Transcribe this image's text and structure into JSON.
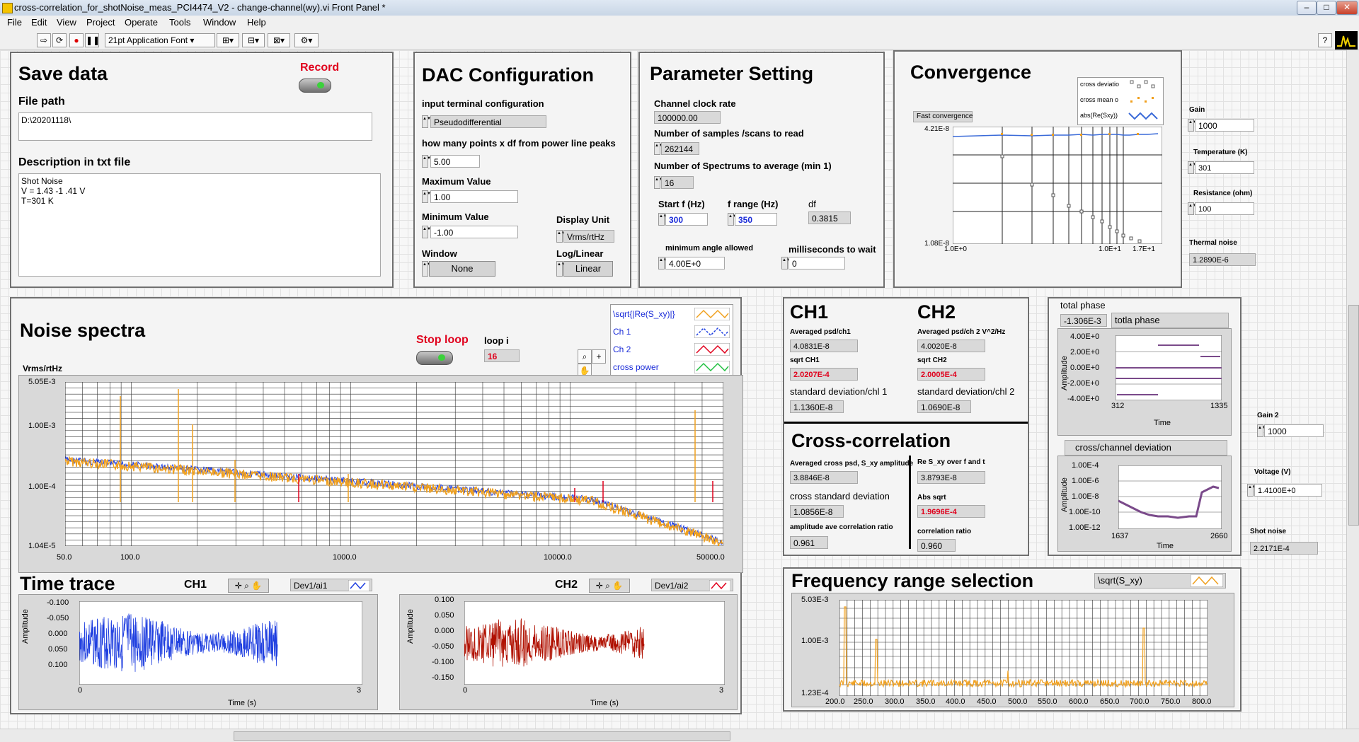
{
  "window": {
    "title": "cross-correlation_for_shotNoise_meas_PCI4474_V2 - change-channel(wy).vi Front Panel *"
  },
  "menu": [
    "File",
    "Edit",
    "View",
    "Project",
    "Operate",
    "Tools",
    "Window",
    "Help"
  ],
  "toolbar": {
    "font": "21pt Application Font"
  },
  "save": {
    "title": "Save data",
    "record_label": "Record",
    "file_path_label": "File path",
    "file_path": "D:\\20201118\\",
    "desc_label": "Description in txt file",
    "desc_lines": [
      "Shot Noise",
      "V = 1.43 -1 .41 V",
      "T=301 K"
    ]
  },
  "dac": {
    "title": "DAC Configuration",
    "input_term_label": "input terminal configuration",
    "input_term": "Pseudodifferential",
    "points_label": "how many points x df from power line peaks",
    "points": "5.00",
    "max_label": "Maximum Value",
    "max": "1.00",
    "min_label": "Minimum Value",
    "min": "-1.00",
    "display_unit_label": "Display Unit",
    "display_unit": "Vrms/rtHz",
    "window_label": "Window",
    "window": "None",
    "loglin_label": "Log/Linear",
    "loglin": "Linear"
  },
  "param": {
    "title": "Parameter Setting",
    "clock_label": "Channel clock rate",
    "clock": "100000.00",
    "samples_label": "Number of samples /scans to read",
    "samples": "262144",
    "spectrums_label": "Number of Spectrums to average (min 1)",
    "spectrums": "16",
    "startf_label": "Start f (Hz)",
    "startf": "300",
    "frange_label": "f range (Hz)",
    "frange": "350",
    "df_label": "df",
    "df": "0.3815",
    "minangle_label": "minimum angle allowed",
    "minangle": "4.00E+0",
    "ms_label": "milliseconds to wait",
    "ms": "0"
  },
  "conv": {
    "title": "Convergence",
    "fast_label": "Fast convergence",
    "legend": [
      "cross deviatio",
      "cross mean o",
      "abs(Re(Sxy))"
    ],
    "y_top": "4.21E-8",
    "y_bot": "1.08E-8",
    "x_ticks": [
      "1.0E+0",
      "1.0E+1",
      "1.7E+1"
    ]
  },
  "right": {
    "gain_label": "Gain",
    "gain": "1000",
    "temp_label": "Temperature (K)",
    "temp": "301",
    "res_label": "Resistance (ohm)",
    "res": "100",
    "thermal_label": "Thermal noise",
    "thermal": "1.2890E-6",
    "gain2_label": "Gain 2",
    "gain2": "1000",
    "voltage_label": "Voltage (V)",
    "voltage": "1.4100E+0",
    "shot_label": "Shot noise",
    "shot": "2.2171E-4"
  },
  "noise": {
    "title": "Noise spectra",
    "stop_label": "Stop loop",
    "loop_label": "loop i",
    "loop": "16",
    "ylabel": "Vrms/rtHz",
    "legend": [
      "\\sqrt{|Re(S_xy)|}",
      "Ch 1",
      "Ch 2",
      "cross power"
    ],
    "y_ticks": [
      "5.05E-3",
      "1.00E-3",
      "1.00E-4",
      "1.04E-5"
    ],
    "x_ticks": [
      "50.0",
      "100.0",
      "1000.0",
      "10000.0",
      "50000.0"
    ]
  },
  "time": {
    "title": "Time trace",
    "ch1_label": "CH1",
    "ch2_label": "CH2",
    "dev1": "Dev1/ai1",
    "dev2": "Dev1/ai2",
    "ch1_y": [
      "-0.100",
      "-0.050",
      "0.000",
      "0.050",
      "0.100"
    ],
    "ch2_y": [
      "0.100",
      "0.050",
      "0.000",
      "-0.050",
      "-0.100",
      "-0.150"
    ],
    "ylabel": "Amplitude",
    "xlabel": "Time (s)",
    "x0": "0",
    "x1": "3"
  },
  "ch": {
    "ch1_title": "CH1",
    "ch2_title": "CH2",
    "avg1_label": "Averaged psd/ch1",
    "avg1": "4.0831E-8",
    "sqrt1_label": "sqrt CH1",
    "sqrt1": "2.0207E-4",
    "sd1_label": "standard deviation/chl 1",
    "sd1": "1.1360E-8",
    "avg2_label": "Averaged psd/ch 2 V^2/Hz",
    "avg2": "4.0020E-8",
    "sqrt2_label": "sqrt CH2",
    "sqrt2": "2.0005E-4",
    "sd2_label": "standard deviation/chl 2",
    "sd2": "1.0690E-8"
  },
  "cc": {
    "title": "Cross-correlation",
    "avg_label": "Averaged cross psd, S_xy amplitude",
    "avg": "3.8846E-8",
    "csd_label": "cross standard deviation",
    "csd": "1.0856E-8",
    "amp_label": "amplitude ave correlation ratio",
    "amp": "0.961",
    "re_label": "Re S_xy over f and t",
    "re": "3.8793E-8",
    "abs_label": "Abs sqrt",
    "abs": "1.9696E-4",
    "corr_label": "correlation ratio",
    "corr": "0.960"
  },
  "phase": {
    "total_label": "total phase",
    "total": "-1.306E-3",
    "legend": "totla phase",
    "y_ticks": [
      "4.00E+0",
      "2.00E+0",
      "0.00E+0",
      "-2.00E+0",
      "-4.00E+0"
    ],
    "x0": "312",
    "x1": "1335",
    "xlabel": "Time",
    "ylabel": "Amplitude"
  },
  "dev": {
    "legend": "cross/channel deviation",
    "y_ticks": [
      "1.00E-4",
      "1.00E-6",
      "1.00E-8",
      "1.00E-10",
      "1.00E-12"
    ],
    "x0": "1637",
    "x1": "2660",
    "xlabel": "Time",
    "ylabel": "Amplitude"
  },
  "freq": {
    "title": "Frequency range selection",
    "legend": "\\sqrt(S_xy)",
    "y_ticks": [
      "5.03E-3",
      "1.00E-3",
      "1.23E-4"
    ],
    "x_ticks": [
      "200.0",
      "250.0",
      "300.0",
      "350.0",
      "400.0",
      "450.0",
      "500.0",
      "550.0",
      "600.0",
      "650.0",
      "700.0",
      "750.0",
      "800.0"
    ]
  },
  "colors": {
    "orange": "#f0a01e",
    "blue": "#1f3fe0",
    "red": "#e0001c",
    "darkred": "#b01000",
    "purple": "#7a4a8a"
  }
}
